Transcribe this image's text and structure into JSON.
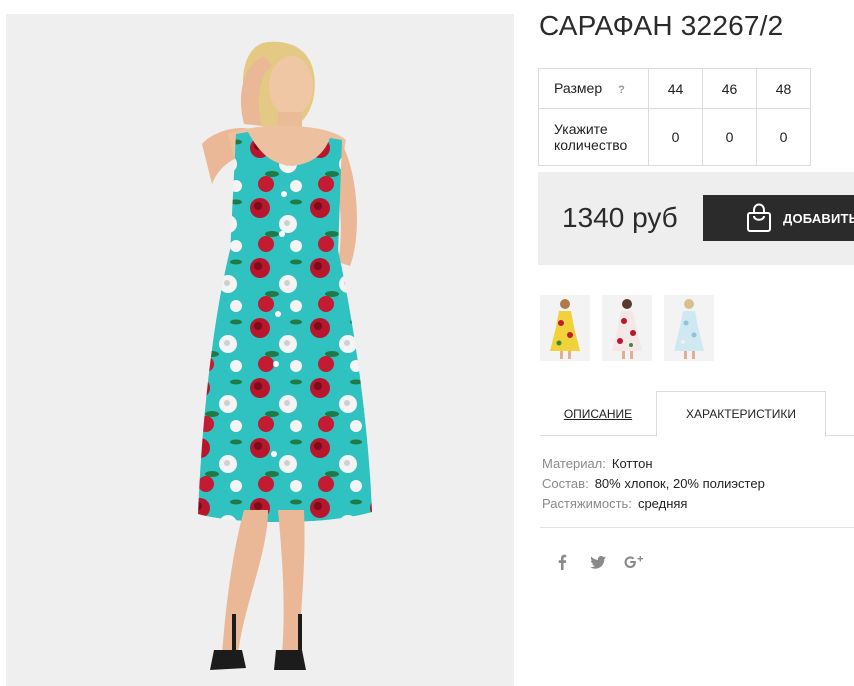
{
  "product": {
    "title": "САРАФАН 32267/2"
  },
  "sizes": {
    "size_label": "Размер",
    "help_label": "?",
    "quantity_label_line1": "Укажите",
    "quantity_label_line2": "количество",
    "columns": [
      {
        "size": "44",
        "qty": "0"
      },
      {
        "size": "46",
        "qty": "0"
      },
      {
        "size": "48",
        "qty": "0"
      }
    ]
  },
  "buy": {
    "price": "1340 руб",
    "add_label": "ДОБАВИТЬ",
    "icon": "shopping-bag-icon"
  },
  "thumbnails": [
    {
      "name": "yellow-dress-thumbnail",
      "color": "#f2d23a"
    },
    {
      "name": "pink-dress-thumbnail",
      "color": "#f5e6e8"
    },
    {
      "name": "light-blue-dress-thumbnail",
      "color": "#cfe9f3"
    }
  ],
  "tabs": {
    "description": "ОПИСАНИЕ",
    "characteristics": "ХАРАКТЕРИСТИКИ",
    "active": "characteristics"
  },
  "specs": [
    {
      "key": "Материал:",
      "value": "Коттон"
    },
    {
      "key": "Состав:",
      "value": "80% хлопок, 20% полиэстер"
    },
    {
      "key": "Растяжимость:",
      "value": "средняя"
    }
  ],
  "social": [
    "facebook-icon",
    "twitter-icon",
    "google-plus-icon"
  ],
  "colors": {
    "button_bg": "#2b2b2b",
    "buy_box_bg": "#eeeeee",
    "dress_turquoise": "#2fc2c0",
    "rose_red": "#b8162c"
  }
}
